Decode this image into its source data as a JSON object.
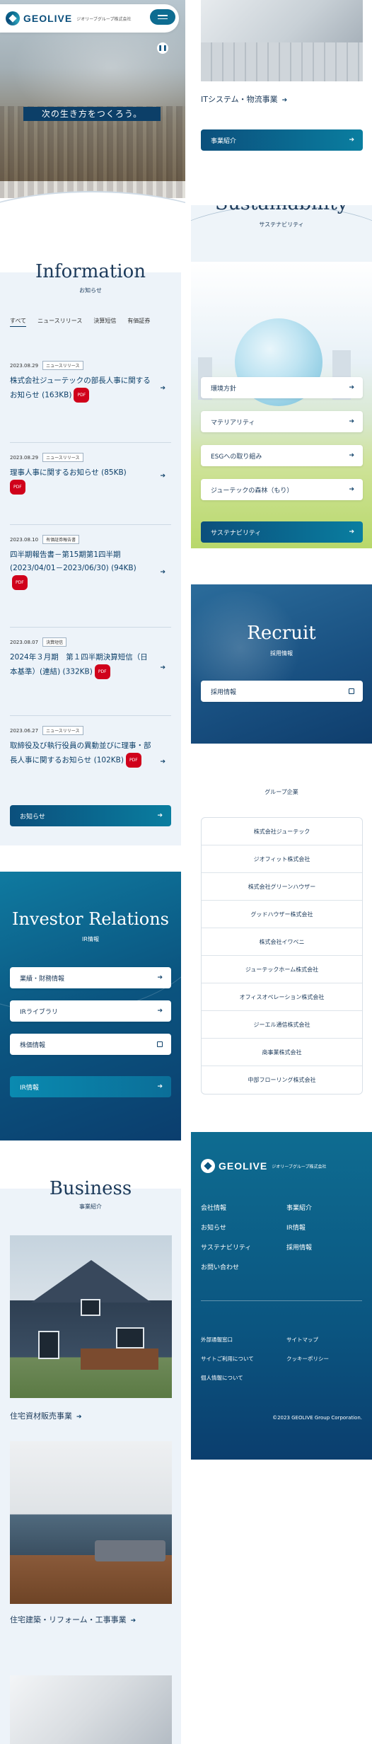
{
  "header": {
    "logo_text": "GEOLIVE",
    "logo_sub": "ジオリーブグループ株式会社",
    "menu_icon": "hamburger-icon",
    "pause_icon": "pause-icon"
  },
  "hero": {
    "copy": "次の生き方をつくろう。"
  },
  "information": {
    "title": "Information",
    "subtitle": "お知らせ",
    "tabs": [
      "すべて",
      "ニュースリリース",
      "決算短信",
      "有価証券"
    ],
    "items": [
      {
        "date": "2023.08.29",
        "tag": "ニュースリリース",
        "title": "株式会社ジューテックの部長人事に関するお知らせ (163KB)",
        "pdf": "PDF"
      },
      {
        "date": "2023.08.29",
        "tag": "ニュースリリース",
        "title": "理事人事に関するお知らせ (85KB)",
        "pdf": "PDF"
      },
      {
        "date": "2023.08.10",
        "tag": "有価証券報告書",
        "title": "四半期報告書－第15期第1四半期 (2023/04/01－2023/06/30) (94KB)",
        "pdf": "PDF"
      },
      {
        "date": "2023.08.07",
        "tag": "決算短信",
        "title": "2024年３月期　第１四半期決算短信（日本基準）(連結) (332KB)",
        "pdf": "PDF"
      },
      {
        "date": "2023.06.27",
        "tag": "ニュースリリース",
        "title": "取締役及び執行役員の異動並びに理事・部長人事に関するお知らせ (102KB)",
        "pdf": "PDF"
      }
    ],
    "button": "お知らせ"
  },
  "ir": {
    "title": "Investor Relations",
    "subtitle": "IR情報",
    "links": [
      "業績・財務情報",
      "IRライブラリ",
      "株価情報"
    ],
    "button": "IR情報"
  },
  "business": {
    "title": "Business",
    "subtitle": "事業紹介",
    "items": [
      "住宅資材販売事業",
      "住宅建築・リフォーム・工事事業",
      "ITシステム・物流事業"
    ],
    "button": "事業紹介"
  },
  "sustainability": {
    "title": "Sustainability",
    "subtitle": "サステナビリティ",
    "links": [
      "環境方針",
      "マテリアリティ",
      "ESGへの取り組み",
      "ジューテックの森林（もり）"
    ],
    "button": "サステナビリティ"
  },
  "recruit": {
    "title": "Recruit",
    "subtitle": "採用情報",
    "link": "採用情報"
  },
  "group": {
    "title": "グループ企業",
    "companies": [
      "株式会社ジューテック",
      "ジオフィット株式会社",
      "株式会社グリーンハウザー",
      "グッドハウザー株式会社",
      "株式会社イワベニ",
      "ジューテックホーム株式会社",
      "オフィスオペレーション株式会社",
      "ジーエル通信株式会社",
      "商事業株式会社",
      "中部フローリング株式会社"
    ]
  },
  "footer": {
    "logo_text": "GEOLIVE",
    "logo_sub": "ジオリーブグループ株式会社",
    "nav": [
      "会社情報",
      "事業紹介",
      "お知らせ",
      "IR情報",
      "サステナビリティ",
      "採用情報",
      "お問い合わせ"
    ],
    "small": [
      "外部通報窓口",
      "サイトマップ",
      "サイトご利用について",
      "クッキーポリシー",
      "個人情報について"
    ],
    "copyright": "©2023 GEOLIVE Group Corporation."
  },
  "colors": {
    "brand": "#0b4f7c",
    "accent": "#0a7ea0",
    "pdf": "#d0021b",
    "bg_light": "#edf3f9"
  }
}
